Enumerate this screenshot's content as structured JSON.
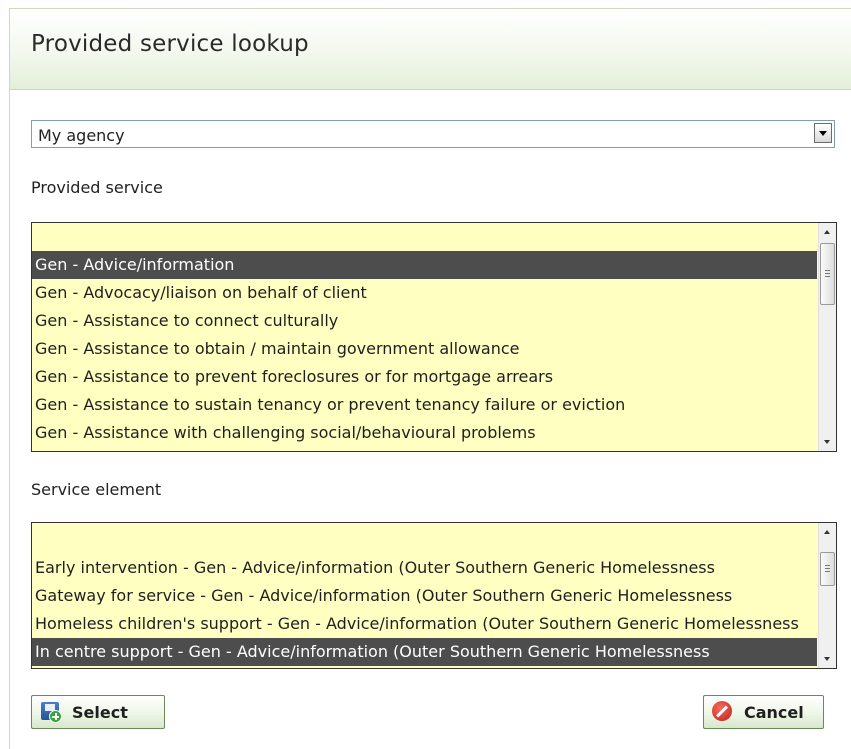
{
  "dialog": {
    "title": "Provided service lookup"
  },
  "agency_select": {
    "value": "My agency"
  },
  "provided_service": {
    "label": "Provided service",
    "items": [
      "",
      "Gen - Advice/information",
      "Gen - Advocacy/liaison on behalf of client",
      "Gen - Assistance to connect culturally",
      "Gen - Assistance to obtain / maintain government allowance",
      "Gen - Assistance to prevent foreclosures or for mortgage arrears",
      "Gen - Assistance to sustain tenancy or prevent tenancy failure or eviction",
      "Gen - Assistance with challenging social/behavioural problems"
    ],
    "selected_index": 1
  },
  "service_element": {
    "label": "Service element",
    "items": [
      "",
      "Early intervention - Gen - Advice/information (Outer Southern Generic Homelessness",
      "Gateway for service - Gen - Advice/information (Outer Southern Generic Homelessness",
      "Homeless children's support - Gen - Advice/information (Outer Southern Generic Homelessness",
      "In centre support - Gen - Advice/information (Outer Southern Generic Homelessness"
    ],
    "selected_index": 4
  },
  "buttons": {
    "select_label": "Select",
    "cancel_label": "Cancel"
  },
  "icons": {
    "select": "save-add-icon",
    "cancel": "cancel-icon",
    "dropdown": "chevron-down-icon"
  }
}
